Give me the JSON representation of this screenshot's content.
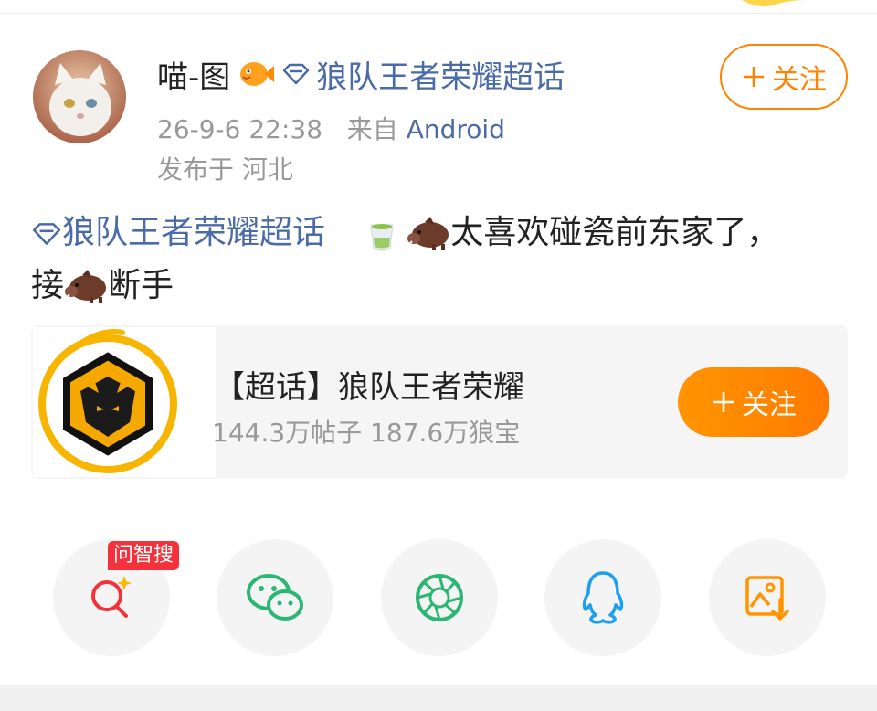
{
  "post": {
    "username": "喵-图",
    "topic_name": "狼队王者荣耀超话",
    "timestamp": "26-9-6 22:38",
    "source_prefix": "来自",
    "source": "Android",
    "location": "发布于 河北",
    "follow_label": "关注",
    "body": {
      "topic": "狼队王者荣耀超话",
      "line1_text": "太喜欢碰瓷前东家了，",
      "line2_prefix": "接",
      "line2_suffix": "断手"
    }
  },
  "card": {
    "title": "【超话】狼队王者荣耀",
    "stats": "144.3万帖子 187.6万狼宝",
    "follow_label": "关注"
  },
  "share": {
    "badge": "问智搜",
    "items": [
      {
        "icon": "ai-search-icon",
        "color": "#f5313b"
      },
      {
        "icon": "wechat-icon",
        "color": "#07c160"
      },
      {
        "icon": "moments-icon",
        "color": "#07c160"
      },
      {
        "icon": "qq-icon",
        "color": "#1ea0f0"
      },
      {
        "icon": "save-image-icon",
        "color": "#ff9500"
      }
    ]
  },
  "colors": {
    "accent": "#ff8200",
    "link": "#4a6aa8",
    "meta": "#999999"
  }
}
